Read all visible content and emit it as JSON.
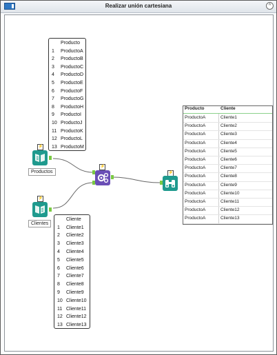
{
  "window": {
    "title": "Realizar unión cartesiana",
    "collapse_glyph": "^"
  },
  "productos_table": {
    "header": "Producto",
    "rows": [
      {
        "n": "1",
        "v": "ProductoA"
      },
      {
        "n": "2",
        "v": "ProductoB"
      },
      {
        "n": "3",
        "v": "ProductoC"
      },
      {
        "n": "4",
        "v": "ProductoD"
      },
      {
        "n": "5",
        "v": "ProductoE"
      },
      {
        "n": "6",
        "v": "ProductoF"
      },
      {
        "n": "7",
        "v": "ProductoG"
      },
      {
        "n": "8",
        "v": "ProductoH"
      },
      {
        "n": "9",
        "v": "ProductoI"
      },
      {
        "n": "10",
        "v": "ProductoJ"
      },
      {
        "n": "11",
        "v": "ProductoK"
      },
      {
        "n": "12",
        "v": "ProductoL"
      },
      {
        "n": "13",
        "v": "ProductoM"
      }
    ]
  },
  "clientes_table": {
    "header": "Cliente",
    "rows": [
      {
        "n": "1",
        "v": "Cliente1"
      },
      {
        "n": "2",
        "v": "Cliente2"
      },
      {
        "n": "3",
        "v": "Cliente3"
      },
      {
        "n": "4",
        "v": "Cliente4"
      },
      {
        "n": "5",
        "v": "Cliente5"
      },
      {
        "n": "6",
        "v": "Cliente6"
      },
      {
        "n": "7",
        "v": "Cliente7"
      },
      {
        "n": "8",
        "v": "Cliente8"
      },
      {
        "n": "9",
        "v": "Cliente9"
      },
      {
        "n": "10",
        "v": "Cliente10"
      },
      {
        "n": "11",
        "v": "Cliente11"
      },
      {
        "n": "12",
        "v": "Cliente12"
      },
      {
        "n": "13",
        "v": "Cliente13"
      }
    ]
  },
  "tools": {
    "productos_label": "Productos",
    "clientes_label": "Clientes",
    "bolt_glyph": "⚡",
    "join_anchor_j": "J",
    "join_anchor_l": "L"
  },
  "browse_table": {
    "columns": [
      "Producto",
      "Cliente"
    ],
    "rows": [
      [
        "ProductoA",
        "Cliente1"
      ],
      [
        "ProductoA",
        "Cliente2"
      ],
      [
        "ProductoA",
        "Cliente3"
      ],
      [
        "ProductoA",
        "Cliente4"
      ],
      [
        "ProductoA",
        "Cliente5"
      ],
      [
        "ProductoA",
        "Cliente6"
      ],
      [
        "ProductoA",
        "Cliente7"
      ],
      [
        "ProductoA",
        "Cliente8"
      ],
      [
        "ProductoA",
        "Cliente9"
      ],
      [
        "ProductoA",
        "Cliente10"
      ],
      [
        "ProductoA",
        "Cliente11"
      ],
      [
        "ProductoA",
        "Cliente12"
      ],
      [
        "ProductoA",
        "Cliente13"
      ]
    ]
  },
  "colors": {
    "tool_teal": "#1f9a8e",
    "tool_purple": "#6a4eb6",
    "anchor_green": "#7ac943",
    "title_icon_blue": "#2f78c4"
  }
}
